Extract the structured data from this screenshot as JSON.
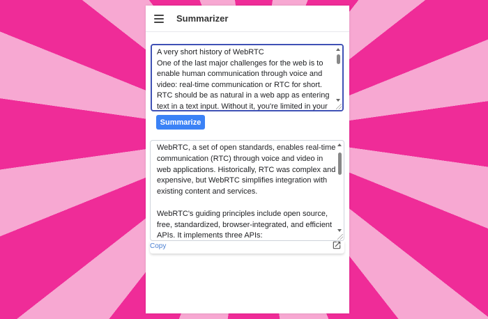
{
  "app": {
    "title": "Summarizer"
  },
  "input": {
    "lines": [
      "A very short history of WebRTC",
      "One of the last major challenges for the web is to enable human communication through voice and video: real-time communication or RTC for short. RTC should be as natural in a web app as entering text in a text input. Without it, you're limited in your ability to"
    ]
  },
  "actions": {
    "summarize_label": "Summarize",
    "copy_label": "Copy"
  },
  "output": {
    "paragraphs": [
      "WebRTC, a set of open standards, enables real-time communication (RTC) through voice and video in web applications. Historically, RTC was complex and expensive, but WebRTC simplifies integration with existing content and services.",
      "WebRTC's guiding principles include open source, free, standardized, browser-integrated, and efficient APIs. It implements three APIs:"
    ]
  },
  "icons": {
    "menu": "menu-icon",
    "open": "open-in-new-icon"
  },
  "colors": {
    "accent": "#3b82f6",
    "focus_border": "#3f51b5",
    "link": "#4a7fd1",
    "background": "#ee1f92"
  }
}
